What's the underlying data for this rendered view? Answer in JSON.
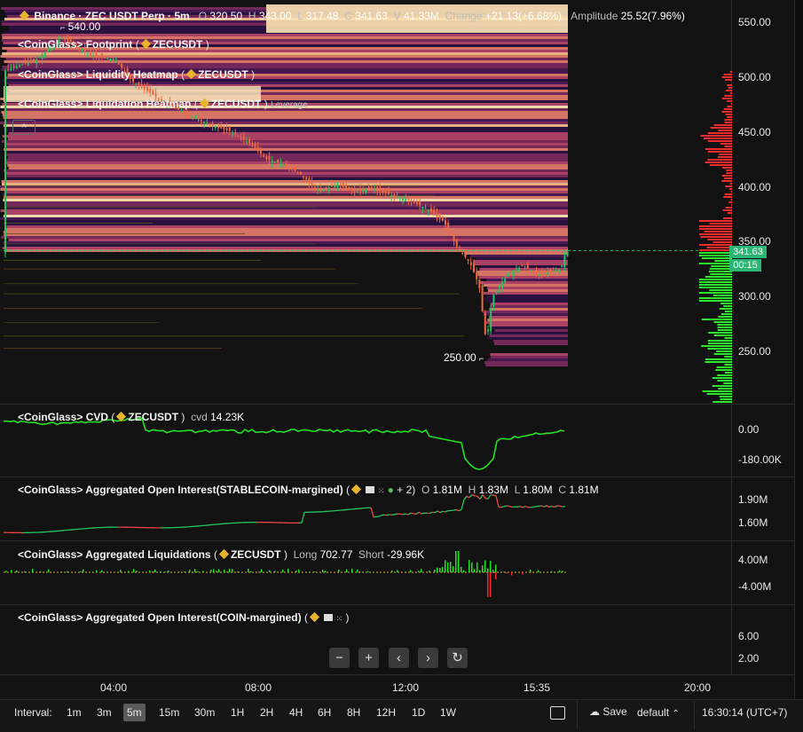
{
  "header": {
    "symbol_label": "Binance · ZEC USDT Perp · 5m",
    "open_key": "O",
    "open_val": "320.50",
    "high_key": "H",
    "high_val": "343.00",
    "low_key": "L",
    "low_val": "317.48",
    "close_key": "C",
    "close_val": "341.63",
    "vol_key": "V",
    "vol_val": "41.33M",
    "change_key": "Change",
    "change_val": "+21.13(+6.68%)",
    "amp_key": "Amplitude",
    "amp_val": "25.52(7.96%)"
  },
  "indicators": {
    "footprint": {
      "name": "<CoinGlass> Footprint",
      "paren_open": "(",
      "symbol": "ZECUSDT",
      "paren_close": ")"
    },
    "liq_heatmap": {
      "name": "<CoinGlass> Liquidity Heatmap",
      "paren_open": "(",
      "symbol": "ZECUSDT",
      "paren_close": ")"
    },
    "liquidation_heatmap": {
      "name": "<CoinGlass> Liquidation Heatmap",
      "paren_open": "(",
      "symbol": "ZECUSDT",
      "paren_close": ")",
      "extra": "Leverage"
    },
    "collapse_label": "^"
  },
  "price_chart": {
    "high_marker": "540.00",
    "low_marker": "250.00",
    "current_price": "341.63",
    "countdown": "00:15",
    "axis_ticks": [
      "550.00",
      "500.00",
      "450.00",
      "400.00",
      "350.00",
      "300.00",
      "250.00"
    ]
  },
  "cvd": {
    "name": "<CoinGlass> CVD",
    "paren_open": "(",
    "symbol": "ZECUSDT",
    "paren_close": ")",
    "key": "cvd",
    "value": "14.23K",
    "axis_ticks": [
      "0.00",
      "-180.00K"
    ]
  },
  "oi_stable": {
    "name": "<CoinGlass> Aggregated Open Interest(STABLECOIN-margined)",
    "paren_open": "(",
    "more": "+ 2)",
    "o_key": "O",
    "o_val": "1.81M",
    "h_key": "H",
    "h_val": "1.83M",
    "l_key": "L",
    "l_val": "1.80M",
    "c_key": "C",
    "c_val": "1.81M",
    "axis_ticks": [
      "1.90M",
      "1.60M"
    ]
  },
  "agg_liq": {
    "name": "<CoinGlass> Aggregated Liquidations",
    "paren_open": "(",
    "symbol": "ZECUSDT",
    "paren_close": ")",
    "long_key": "Long",
    "long_val": "702.77",
    "short_key": "Short",
    "short_val": "-29.96K",
    "axis_ticks": [
      "4.00M",
      "-4.00M"
    ]
  },
  "oi_coin": {
    "name": "<CoinGlass> Aggregated Open Interest(COIN-margined)",
    "paren_open": "(",
    "paren_close": ")",
    "axis_ticks": [
      "6.00",
      "2.00"
    ]
  },
  "nav_buttons": {
    "zoom_out": "−",
    "zoom_in": "+",
    "prev": "‹",
    "next": "›",
    "reset": "↻"
  },
  "time_axis": [
    "04:00",
    "08:00",
    "12:00",
    "15:35",
    "20:00"
  ],
  "bottom_bar": {
    "interval_label": "Interval:",
    "intervals": [
      "1m",
      "3m",
      "5m",
      "15m",
      "30m",
      "1H",
      "2H",
      "4H",
      "6H",
      "8H",
      "12H",
      "1D",
      "1W"
    ],
    "active_interval": "5m",
    "save_label": "Save",
    "layout_name": "default",
    "clock": "16:30:14 (UTC+7)"
  },
  "colors": {
    "up": "#22c55e",
    "down": "#ef4444",
    "accent_tag": "#2bb673",
    "heat_hot": "#fbe3b4",
    "heat_cold": "#2a1240"
  }
}
